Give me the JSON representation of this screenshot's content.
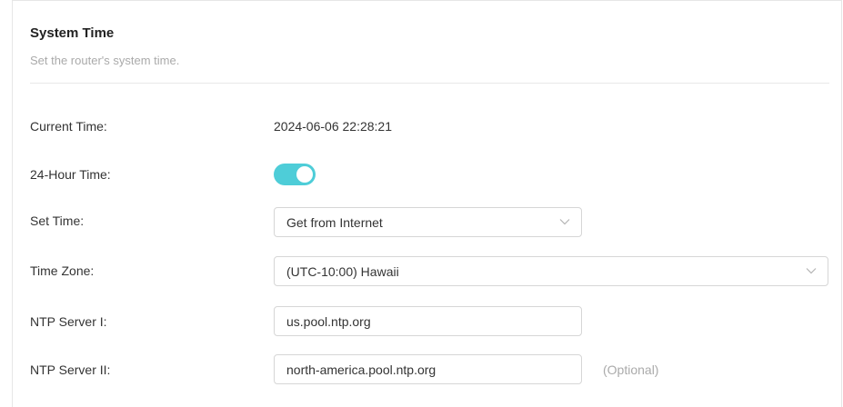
{
  "section": {
    "title": "System Time",
    "subtitle": "Set the router's system time."
  },
  "current_time": {
    "label": "Current Time:",
    "value": "2024-06-06 22:28:21"
  },
  "hour24": {
    "label": "24-Hour Time:",
    "enabled": true,
    "accent_color": "#4ecdd8"
  },
  "set_time": {
    "label": "Set Time:",
    "selected": "Get from Internet"
  },
  "time_zone": {
    "label": "Time Zone:",
    "selected": "(UTC-10:00) Hawaii"
  },
  "ntp1": {
    "label": "NTP Server I:",
    "value": "us.pool.ntp.org"
  },
  "ntp2": {
    "label": "NTP Server II:",
    "value": "north-america.pool.ntp.org",
    "hint": "(Optional)"
  },
  "icons": {
    "dropdown": "chevron-down-icon"
  }
}
